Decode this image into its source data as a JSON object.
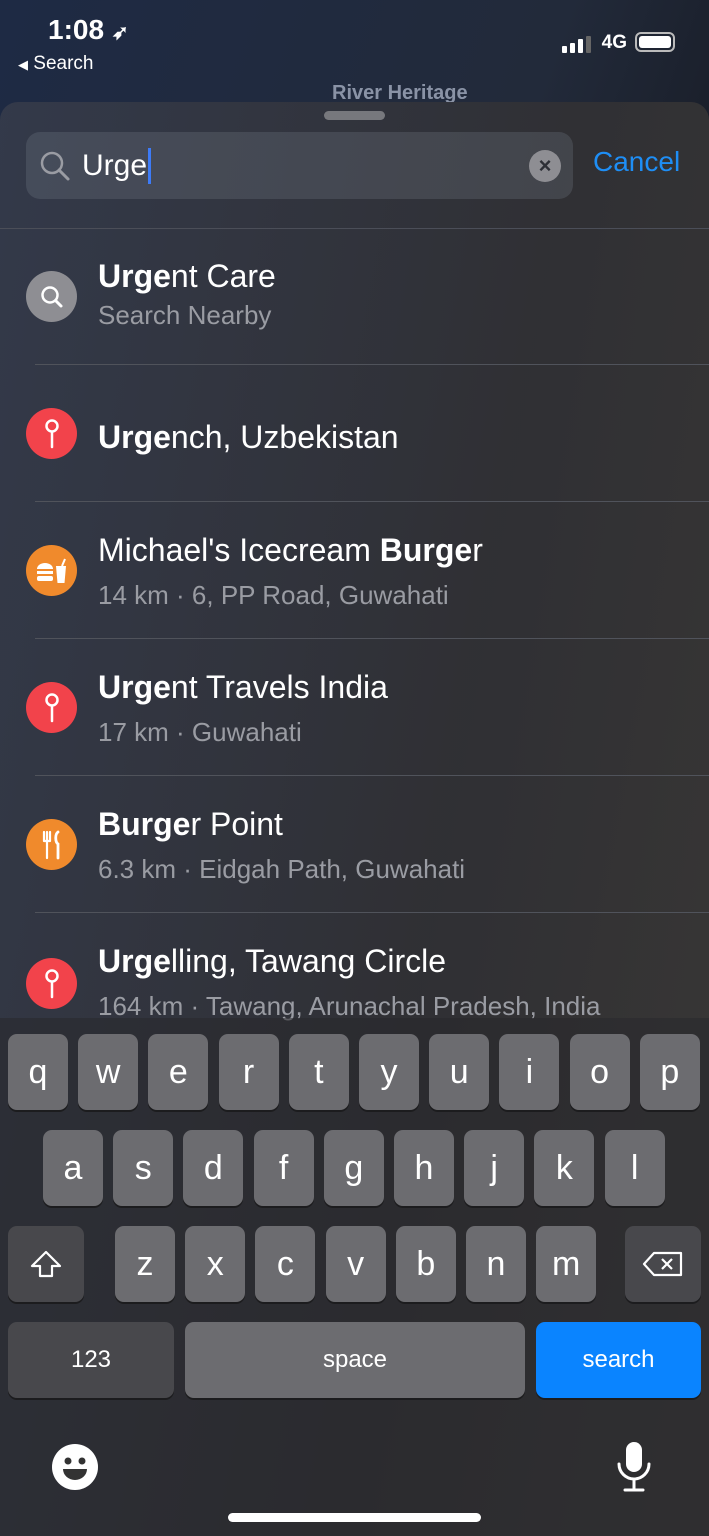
{
  "status": {
    "time": "1:08",
    "back": "Search",
    "network": "4G"
  },
  "map": {
    "label": "River Heritage"
  },
  "search": {
    "value": "Urge",
    "cancel": "Cancel"
  },
  "results": [
    {
      "bold": "Urge",
      "rest": "nt Care",
      "sub": "Search Nearby",
      "icon": "search-icon",
      "color": "#8e8e93"
    },
    {
      "bold": "Urge",
      "rest": "nch, Uzbekistan",
      "sub": "",
      "icon": "pin-icon",
      "color": "#f2434b"
    },
    {
      "bold": "",
      "rest": "Michael's Icecream ",
      "bold2": "Burge",
      "rest2": "r",
      "sub": "14 km · 6, PP Road, Guwahati",
      "icon": "fast-food-icon",
      "color": "#f08a2c"
    },
    {
      "bold": "Urge",
      "rest": "nt Travels India",
      "sub": "17 km · Guwahati",
      "icon": "pin-icon",
      "color": "#f2434b"
    },
    {
      "bold": "Burge",
      "rest": "r Point",
      "sub": "6.3 km · Eidgah Path, Guwahati",
      "icon": "restaurant-icon",
      "color": "#f08a2c"
    },
    {
      "bold": "Urge",
      "rest": "lling, Tawang Circle",
      "sub": "164 km · Tawang, Arunachal Pradesh, India",
      "icon": "pin-icon",
      "color": "#f2434b"
    }
  ],
  "keyboard": {
    "row1": [
      "q",
      "w",
      "e",
      "r",
      "t",
      "y",
      "u",
      "i",
      "o",
      "p"
    ],
    "row2": [
      "a",
      "s",
      "d",
      "f",
      "g",
      "h",
      "j",
      "k",
      "l"
    ],
    "row3": [
      "z",
      "x",
      "c",
      "v",
      "b",
      "n",
      "m"
    ],
    "numbers": "123",
    "space": "space",
    "search": "search"
  }
}
